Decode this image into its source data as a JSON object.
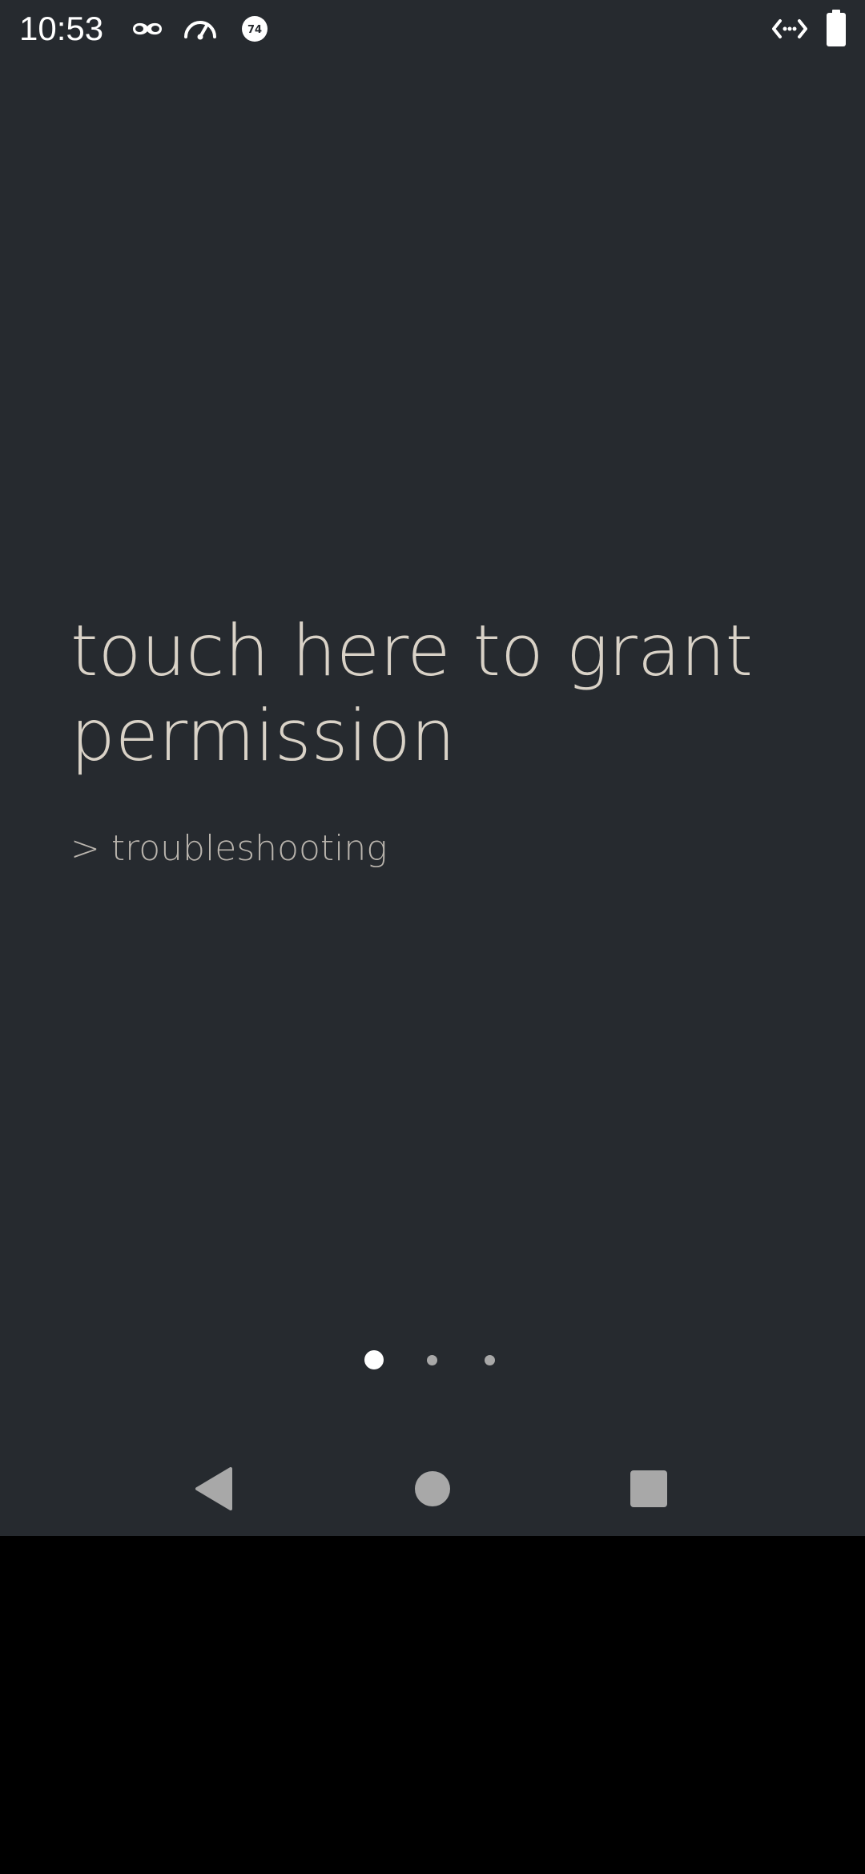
{
  "status_bar": {
    "time": "10:53",
    "left_icons": [
      "incognito-icon",
      "speedometer-icon",
      "badge-74-icon"
    ],
    "badge_number": "74",
    "right_icons": [
      "code-arrows-icon",
      "battery-icon"
    ]
  },
  "main": {
    "title": "touch here to grant permission",
    "link": "> troubleshooting",
    "title_color": "#d9d2c7",
    "link_color": "#b9b4ad"
  },
  "pager": {
    "pages": 3,
    "active_index": 0
  },
  "nav_bar": {
    "buttons": [
      "back-icon",
      "home-icon",
      "recents-icon"
    ]
  },
  "colors": {
    "background": "#262a2f",
    "below_screen": "#000000",
    "nav_icons": "#a8a8a8"
  }
}
